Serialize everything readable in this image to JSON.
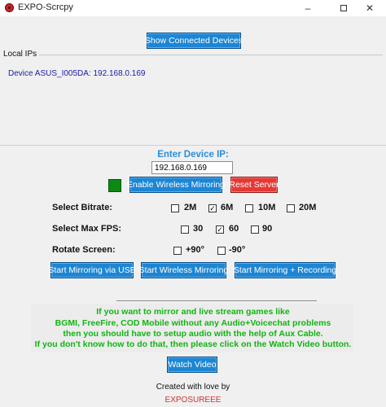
{
  "window": {
    "title": "EXPO-Scrcpy",
    "minimize": "–",
    "close": "✕"
  },
  "buttons": {
    "show_devices": "Show Connected Devices",
    "enable_wireless": "Enable Wireless Mirroring",
    "reset_server": "Reset Server",
    "start_usb": "Start Mirroring via USB",
    "start_wireless": "Start Wireless Mirroring",
    "start_recording": "Start Mirroring + Recording",
    "watch_video": "Watch Video"
  },
  "local_ips": {
    "label": "Local IPs",
    "device": "Device ASUS_I005DA: 192.168.0.169"
  },
  "ip_entry": {
    "label": "Enter Device IP:",
    "value": "192.168.0.169"
  },
  "status": {
    "color": "#0a8a12"
  },
  "bitrate": {
    "label": "Select Bitrate:",
    "options": [
      {
        "label": "2M",
        "checked": false
      },
      {
        "label": "6M",
        "checked": true
      },
      {
        "label": "10M",
        "checked": false
      },
      {
        "label": "20M",
        "checked": false
      }
    ]
  },
  "fps": {
    "label": "Select Max FPS:",
    "options": [
      {
        "label": "30",
        "checked": false
      },
      {
        "label": "60",
        "checked": true
      },
      {
        "label": "90",
        "checked": false
      }
    ]
  },
  "rotate": {
    "label": "Rotate Screen:",
    "options": [
      {
        "label": "+90°",
        "checked": false
      },
      {
        "label": "-90°",
        "checked": false
      }
    ]
  },
  "info": {
    "lines": [
      "If you want to mirror and live stream games like",
      "BGMI, FreeFire, COD Mobile without any Audio+Voicechat problems",
      "then you should have to setup audio with the help of Aux Cable.",
      "If you don't know how to do that, then please click on the Watch Video button."
    ]
  },
  "credits": {
    "line": "Created with love by",
    "author": "EXPOSUREEE"
  },
  "colors": {
    "accent": "#1d86d4",
    "reset": "#e53935",
    "info_text": "#13b313",
    "author": "#d32f2f"
  }
}
